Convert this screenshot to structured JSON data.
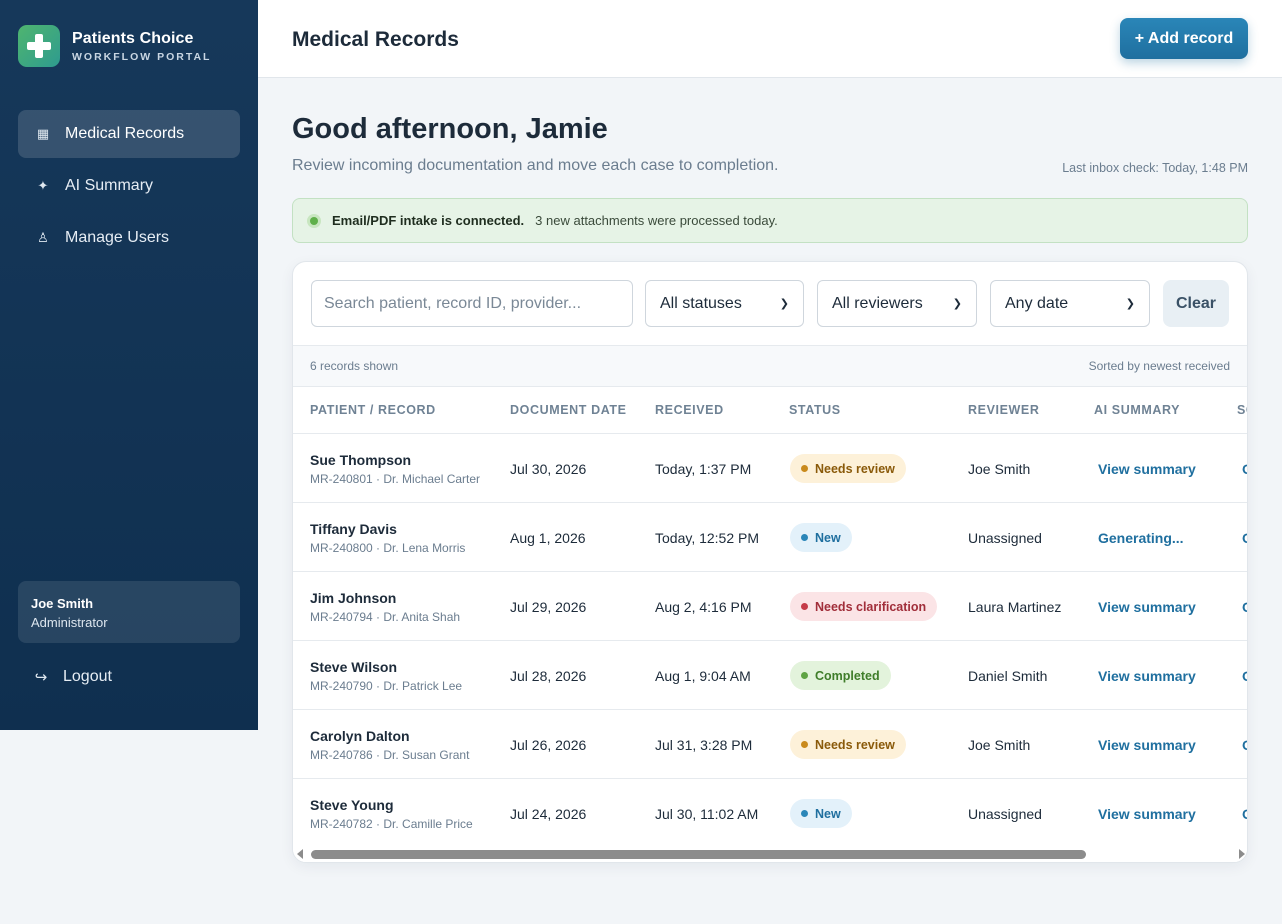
{
  "brand": {
    "name": "Patients Choice",
    "subtitle": "WORKFLOW PORTAL"
  },
  "sidebar": {
    "items": [
      {
        "label": "Medical Records",
        "icon": "grid-icon",
        "active": true
      },
      {
        "label": "AI Summary",
        "icon": "sparkle-icon",
        "active": false
      },
      {
        "label": "Manage Users",
        "icon": "user-icon",
        "active": false
      }
    ],
    "user": {
      "name": "Joe Smith",
      "role": "Administrator"
    },
    "logout_label": "Logout"
  },
  "header": {
    "title": "Medical Records",
    "add_button": "+ Add record"
  },
  "main": {
    "greeting": "Good afternoon, Jamie",
    "subtitle": "Review incoming documentation and move each case to completion.",
    "last_check": "Last inbox check: Today, 1:48 PM",
    "notice": {
      "strong": "Email/PDF intake is connected.",
      "text": "3 new attachments were processed today."
    }
  },
  "filters": {
    "search_placeholder": "Search patient, record ID, provider...",
    "status": "All statuses",
    "reviewer": "All reviewers",
    "date": "Any date",
    "clear": "Clear"
  },
  "table": {
    "count": "6 records shown",
    "sort": "Sorted by newest received",
    "headers": [
      "PATIENT / RECORD",
      "DOCUMENT DATE",
      "RECEIVED",
      "STATUS",
      "REVIEWER",
      "AI SUMMARY",
      "SO"
    ],
    "rows": [
      {
        "name": "Sue Thompson",
        "sub": "MR-240801 · Dr. Michael Carter",
        "doc_date": "Jul 30, 2026",
        "received": "Today, 1:37 PM",
        "status": "Needs review",
        "status_type": "review",
        "reviewer": "Joe Smith",
        "summary": "View summary",
        "extra": "O"
      },
      {
        "name": "Tiffany Davis",
        "sub": "MR-240800 · Dr. Lena Morris",
        "doc_date": "Aug 1, 2026",
        "received": "Today, 12:52 PM",
        "status": "New",
        "status_type": "new",
        "reviewer": "Unassigned",
        "summary": "Generating...",
        "extra": "O"
      },
      {
        "name": "Jim Johnson",
        "sub": "MR-240794 · Dr. Anita Shah",
        "doc_date": "Jul 29, 2026",
        "received": "Aug 2, 4:16 PM",
        "status": "Needs clarification",
        "status_type": "clar",
        "reviewer": "Laura Martinez",
        "summary": "View summary",
        "extra": "O"
      },
      {
        "name": "Steve Wilson",
        "sub": "MR-240790 · Dr. Patrick Lee",
        "doc_date": "Jul 28, 2026",
        "received": "Aug 1, 9:04 AM",
        "status": "Completed",
        "status_type": "done",
        "reviewer": "Daniel Smith",
        "summary": "View summary",
        "extra": "O"
      },
      {
        "name": "Carolyn Dalton",
        "sub": "MR-240786 · Dr. Susan Grant",
        "doc_date": "Jul 26, 2026",
        "received": "Jul 31, 3:28 PM",
        "status": "Needs review",
        "status_type": "review",
        "reviewer": "Joe Smith",
        "summary": "View summary",
        "extra": "O"
      },
      {
        "name": "Steve Young",
        "sub": "MR-240782 · Dr. Camille Price",
        "doc_date": "Jul 24, 2026",
        "received": "Jul 30, 11:02 AM",
        "status": "New",
        "status_type": "new",
        "reviewer": "Unassigned",
        "summary": "View summary",
        "extra": "O"
      }
    ]
  },
  "colors": {
    "sidebar": "#16385a",
    "accent": "#1f6f9f",
    "success": "#5fb04a"
  }
}
